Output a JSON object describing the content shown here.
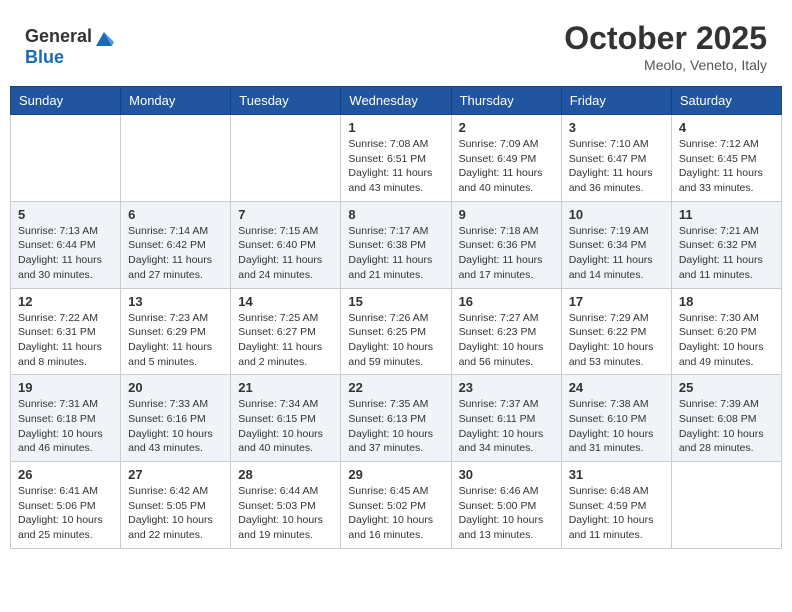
{
  "header": {
    "logo": {
      "general": "General",
      "blue": "Blue"
    },
    "title": "October 2025",
    "location": "Meolo, Veneto, Italy"
  },
  "weekdays": [
    "Sunday",
    "Monday",
    "Tuesday",
    "Wednesday",
    "Thursday",
    "Friday",
    "Saturday"
  ],
  "weeks": [
    [
      {
        "day": "",
        "info": ""
      },
      {
        "day": "",
        "info": ""
      },
      {
        "day": "",
        "info": ""
      },
      {
        "day": "1",
        "info": "Sunrise: 7:08 AM\nSunset: 6:51 PM\nDaylight: 11 hours\nand 43 minutes."
      },
      {
        "day": "2",
        "info": "Sunrise: 7:09 AM\nSunset: 6:49 PM\nDaylight: 11 hours\nand 40 minutes."
      },
      {
        "day": "3",
        "info": "Sunrise: 7:10 AM\nSunset: 6:47 PM\nDaylight: 11 hours\nand 36 minutes."
      },
      {
        "day": "4",
        "info": "Sunrise: 7:12 AM\nSunset: 6:45 PM\nDaylight: 11 hours\nand 33 minutes."
      }
    ],
    [
      {
        "day": "5",
        "info": "Sunrise: 7:13 AM\nSunset: 6:44 PM\nDaylight: 11 hours\nand 30 minutes."
      },
      {
        "day": "6",
        "info": "Sunrise: 7:14 AM\nSunset: 6:42 PM\nDaylight: 11 hours\nand 27 minutes."
      },
      {
        "day": "7",
        "info": "Sunrise: 7:15 AM\nSunset: 6:40 PM\nDaylight: 11 hours\nand 24 minutes."
      },
      {
        "day": "8",
        "info": "Sunrise: 7:17 AM\nSunset: 6:38 PM\nDaylight: 11 hours\nand 21 minutes."
      },
      {
        "day": "9",
        "info": "Sunrise: 7:18 AM\nSunset: 6:36 PM\nDaylight: 11 hours\nand 17 minutes."
      },
      {
        "day": "10",
        "info": "Sunrise: 7:19 AM\nSunset: 6:34 PM\nDaylight: 11 hours\nand 14 minutes."
      },
      {
        "day": "11",
        "info": "Sunrise: 7:21 AM\nSunset: 6:32 PM\nDaylight: 11 hours\nand 11 minutes."
      }
    ],
    [
      {
        "day": "12",
        "info": "Sunrise: 7:22 AM\nSunset: 6:31 PM\nDaylight: 11 hours\nand 8 minutes."
      },
      {
        "day": "13",
        "info": "Sunrise: 7:23 AM\nSunset: 6:29 PM\nDaylight: 11 hours\nand 5 minutes."
      },
      {
        "day": "14",
        "info": "Sunrise: 7:25 AM\nSunset: 6:27 PM\nDaylight: 11 hours\nand 2 minutes."
      },
      {
        "day": "15",
        "info": "Sunrise: 7:26 AM\nSunset: 6:25 PM\nDaylight: 10 hours\nand 59 minutes."
      },
      {
        "day": "16",
        "info": "Sunrise: 7:27 AM\nSunset: 6:23 PM\nDaylight: 10 hours\nand 56 minutes."
      },
      {
        "day": "17",
        "info": "Sunrise: 7:29 AM\nSunset: 6:22 PM\nDaylight: 10 hours\nand 53 minutes."
      },
      {
        "day": "18",
        "info": "Sunrise: 7:30 AM\nSunset: 6:20 PM\nDaylight: 10 hours\nand 49 minutes."
      }
    ],
    [
      {
        "day": "19",
        "info": "Sunrise: 7:31 AM\nSunset: 6:18 PM\nDaylight: 10 hours\nand 46 minutes."
      },
      {
        "day": "20",
        "info": "Sunrise: 7:33 AM\nSunset: 6:16 PM\nDaylight: 10 hours\nand 43 minutes."
      },
      {
        "day": "21",
        "info": "Sunrise: 7:34 AM\nSunset: 6:15 PM\nDaylight: 10 hours\nand 40 minutes."
      },
      {
        "day": "22",
        "info": "Sunrise: 7:35 AM\nSunset: 6:13 PM\nDaylight: 10 hours\nand 37 minutes."
      },
      {
        "day": "23",
        "info": "Sunrise: 7:37 AM\nSunset: 6:11 PM\nDaylight: 10 hours\nand 34 minutes."
      },
      {
        "day": "24",
        "info": "Sunrise: 7:38 AM\nSunset: 6:10 PM\nDaylight: 10 hours\nand 31 minutes."
      },
      {
        "day": "25",
        "info": "Sunrise: 7:39 AM\nSunset: 6:08 PM\nDaylight: 10 hours\nand 28 minutes."
      }
    ],
    [
      {
        "day": "26",
        "info": "Sunrise: 6:41 AM\nSunset: 5:06 PM\nDaylight: 10 hours\nand 25 minutes."
      },
      {
        "day": "27",
        "info": "Sunrise: 6:42 AM\nSunset: 5:05 PM\nDaylight: 10 hours\nand 22 minutes."
      },
      {
        "day": "28",
        "info": "Sunrise: 6:44 AM\nSunset: 5:03 PM\nDaylight: 10 hours\nand 19 minutes."
      },
      {
        "day": "29",
        "info": "Sunrise: 6:45 AM\nSunset: 5:02 PM\nDaylight: 10 hours\nand 16 minutes."
      },
      {
        "day": "30",
        "info": "Sunrise: 6:46 AM\nSunset: 5:00 PM\nDaylight: 10 hours\nand 13 minutes."
      },
      {
        "day": "31",
        "info": "Sunrise: 6:48 AM\nSunset: 4:59 PM\nDaylight: 10 hours\nand 11 minutes."
      },
      {
        "day": "",
        "info": ""
      }
    ]
  ]
}
